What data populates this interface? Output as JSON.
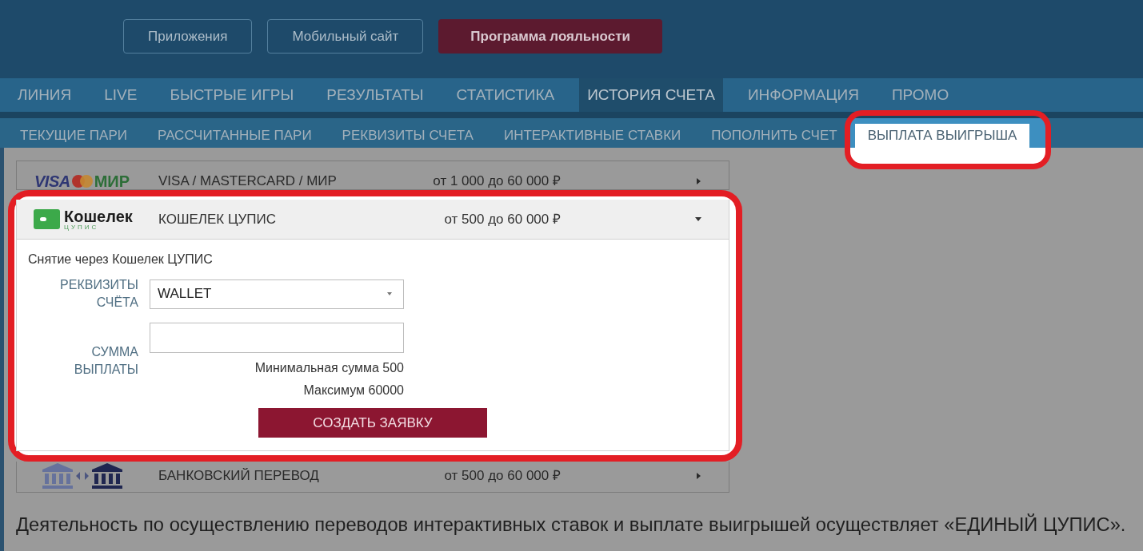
{
  "header_buttons": [
    {
      "label": "Приложения",
      "kind": "outline"
    },
    {
      "label": "Мобильный сайт",
      "kind": "outline"
    },
    {
      "label": "Программа лояльности",
      "kind": "primary"
    }
  ],
  "main_nav": [
    {
      "label": "ЛИНИЯ",
      "selected": false
    },
    {
      "label": "LIVE",
      "selected": false
    },
    {
      "label": "БЫСТРЫЕ ИГРЫ",
      "selected": false
    },
    {
      "label": "РЕЗУЛЬТАТЫ",
      "selected": false
    },
    {
      "label": "СТАТИСТИКА",
      "selected": false
    },
    {
      "label": "ИСТОРИЯ СЧЕТА",
      "selected": true
    },
    {
      "label": "ИНФОРМАЦИЯ",
      "selected": false
    },
    {
      "label": "ПРОМО",
      "selected": false
    }
  ],
  "sub_nav": [
    {
      "label": "ТЕКУЩИЕ ПАРИ",
      "selected": false,
      "highlighted": false
    },
    {
      "label": "РАССЧИТАННЫЕ ПАРИ",
      "selected": false,
      "highlighted": false
    },
    {
      "label": "РЕКВИЗИТЫ СЧЕТА",
      "selected": false,
      "highlighted": false
    },
    {
      "label": "ИНТЕРАКТИВНЫЕ СТАВКИ",
      "selected": false,
      "highlighted": false
    },
    {
      "label": "ПОПОЛНИТЬ СЧЕТ",
      "selected": false,
      "highlighted": false
    },
    {
      "label": "ВЫПЛАТА ВЫИГРЫША",
      "selected": true,
      "highlighted": true
    }
  ],
  "payment_methods": [
    {
      "kind": "cards",
      "logo": [
        "VISA",
        "МИР"
      ],
      "name": "VISA / MASTERCARD / МИР",
      "range": "от 1 000 до 60 000 ₽",
      "expanded": false,
      "highlighted": false
    },
    {
      "kind": "wallet",
      "logo": [
        "Кошелек",
        "ЦУПИС"
      ],
      "name": "КОШЕЛЕК ЦУПИС",
      "range": "от 500 до 60 000 ₽",
      "expanded": true,
      "highlighted": true,
      "form": {
        "title": "Снятие через Кошелек ЦУПИС",
        "fields": [
          {
            "kind": "select",
            "label": "РЕКВИЗИТЫ СЧЁТА",
            "value": "WALLET"
          },
          {
            "kind": "input",
            "label": "СУММА ВЫПЛАТЫ",
            "hints": [
              "Минимальная сумма 500",
              "Максимум 60000"
            ]
          }
        ],
        "submit": "СОЗДАТЬ ЗАЯВКУ"
      }
    },
    {
      "kind": "bank",
      "name": "БАНКОВСКИЙ ПЕРЕВОД",
      "range": "от 500 до 60 000 ₽",
      "expanded": false,
      "highlighted": false
    }
  ],
  "footer_note": "Деятельность по осуществлению переводов интерактивных ставок и выплате выигрышей осуществляет «ЕДИНЫЙ ЦУПИС»."
}
